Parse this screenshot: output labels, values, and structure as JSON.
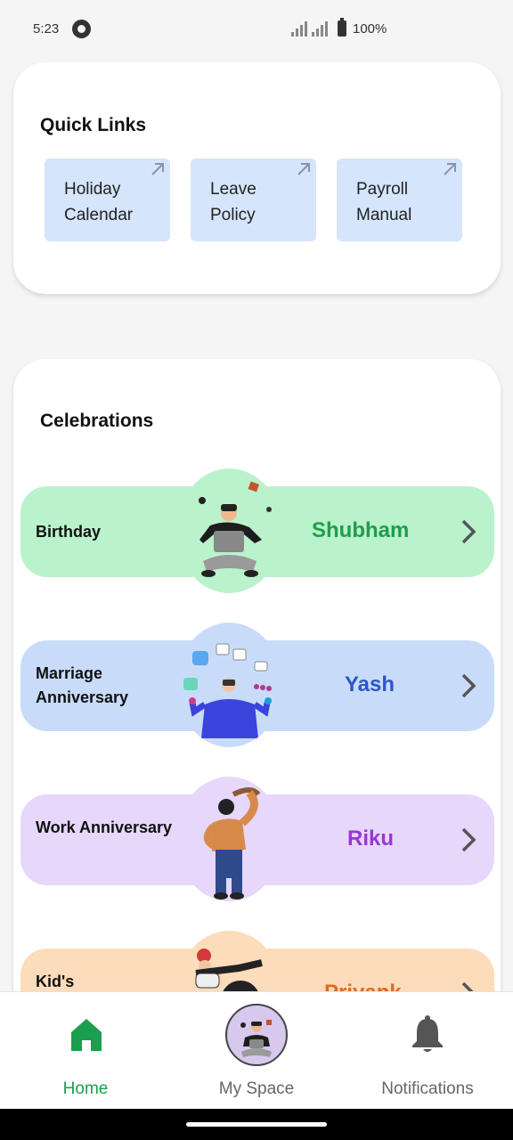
{
  "status_bar": {
    "time": "5:23",
    "battery": "100%",
    "icons": [
      "whatsapp-icon",
      "signal-icon",
      "signal-icon",
      "battery-icon"
    ]
  },
  "quick_links": {
    "title": "Quick Links",
    "items": [
      {
        "label": "Holiday Calendar",
        "icon": "arrow-up-right-icon"
      },
      {
        "label": "Leave Policy",
        "icon": "arrow-up-right-icon"
      },
      {
        "label": "Payroll Manual",
        "icon": "arrow-up-right-icon"
      }
    ],
    "tile_color": "#d4e5fc"
  },
  "celebrations": {
    "title": "Celebrations",
    "items": [
      {
        "label": "Birthday",
        "name": "Shubham",
        "band_color": "#baf2cc",
        "name_color": "#1e9e4b",
        "icon": "chevron-right-icon"
      },
      {
        "label": "Marriage Anniversary",
        "name": "Yash",
        "band_color": "#c8dcfa",
        "name_color": "#2d55c8",
        "icon": "chevron-right-icon"
      },
      {
        "label": "Work Anniversary",
        "name": "Riku",
        "band_color": "#e6d7fb",
        "name_color": "#9a36d6",
        "icon": "chevron-right-icon"
      },
      {
        "label": "Kid's",
        "name": "Priyank",
        "band_color": "#fddcbb",
        "name_color": "#e06a20",
        "icon": "chevron-right-icon"
      }
    ]
  },
  "bottom_nav": {
    "items": [
      {
        "label": "Home",
        "icon": "home-icon",
        "active": true
      },
      {
        "label": "My Space",
        "icon": "avatar",
        "active": false
      },
      {
        "label": "Notifications",
        "icon": "bell-icon",
        "active": false
      }
    ],
    "active_color": "#1b9e4f",
    "inactive_color": "#666666"
  }
}
